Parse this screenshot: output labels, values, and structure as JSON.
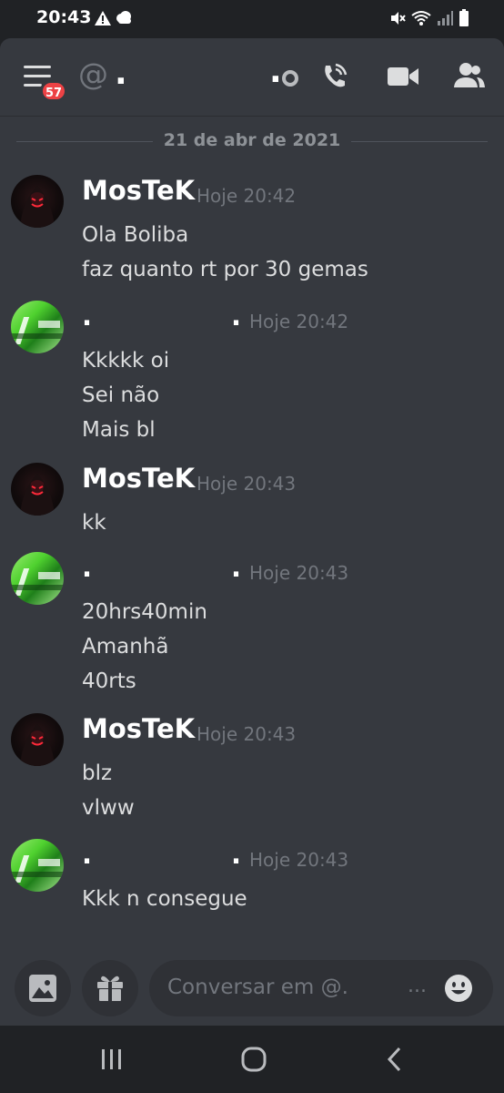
{
  "status_bar": {
    "time": "20:43",
    "icons": [
      "warning-icon",
      "cloud-icon",
      "mute-icon",
      "wifi-icon",
      "signal-icon",
      "battery-icon"
    ]
  },
  "header": {
    "badge_count": "57",
    "channel_prefix_icon": "at-icon",
    "channel_name": ".",
    "status_dot": ".",
    "icons": [
      "phone-call-icon",
      "video-icon",
      "members-icon"
    ]
  },
  "date_divider": "21 de abr de 2021",
  "messages": [
    {
      "author": "MosTeK",
      "author_suffix": "",
      "time": "Hoje 20:42",
      "lines": [
        "Ola Boliba",
        "faz quanto rt por 30 gemas"
      ]
    },
    {
      "author": ".",
      "author_suffix": ".",
      "time": "Hoje 20:42",
      "lines": [
        "Kkkkk oi",
        "Sei não",
        "Mais bl"
      ]
    },
    {
      "author": "MosTeK",
      "author_suffix": "",
      "time": "Hoje 20:43",
      "lines": [
        "kk"
      ]
    },
    {
      "author": ".",
      "author_suffix": ".",
      "time": "Hoje 20:43",
      "lines": [
        "20hrs40min",
        "Amanhã",
        "40rts"
      ]
    },
    {
      "author": "MosTeK",
      "author_suffix": "",
      "time": "Hoje 20:43",
      "lines": [
        "blz",
        "vlww"
      ]
    },
    {
      "author": ".",
      "author_suffix": ".",
      "time": "Hoje 20:43",
      "lines": [
        "Kkk n consegue"
      ]
    }
  ],
  "composer": {
    "placeholder": "Conversar em @.",
    "ellipsis": "..."
  },
  "colors": {
    "background": "#36393f",
    "header_text": "#ffffff",
    "timestamp": "#72767d",
    "badge": "#ed4245"
  }
}
